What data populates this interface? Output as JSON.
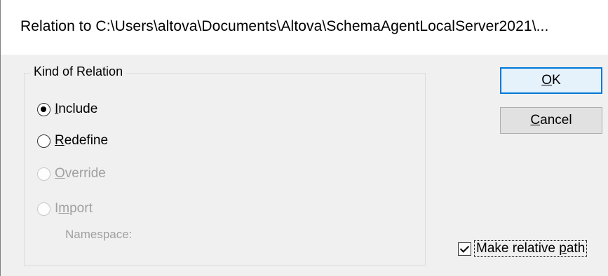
{
  "window": {
    "title": "Relation to C:\\Users\\altova\\Documents\\Altova\\SchemaAgentLocalServer2021\\..."
  },
  "kind_group": {
    "legend": "Kind of Relation",
    "options": [
      {
        "id": "include",
        "pre": "",
        "accel": "I",
        "post": "nclude",
        "checked": true,
        "enabled": true
      },
      {
        "id": "redefine",
        "pre": "",
        "accel": "R",
        "post": "edefine",
        "checked": false,
        "enabled": true
      },
      {
        "id": "override",
        "pre": "",
        "accel": "O",
        "post": "verride",
        "checked": false,
        "enabled": false
      },
      {
        "id": "import",
        "pre": "I",
        "accel": "m",
        "post": "port",
        "checked": false,
        "enabled": false
      }
    ],
    "namespace_label": "Namespace:"
  },
  "buttons": {
    "ok": {
      "accel": "O",
      "rest": "K"
    },
    "cancel": {
      "accel": "C",
      "rest": "ancel"
    }
  },
  "relative_path": {
    "label_pre": "Make relative ",
    "label_accel": "p",
    "label_post": "ath",
    "checked": true
  }
}
